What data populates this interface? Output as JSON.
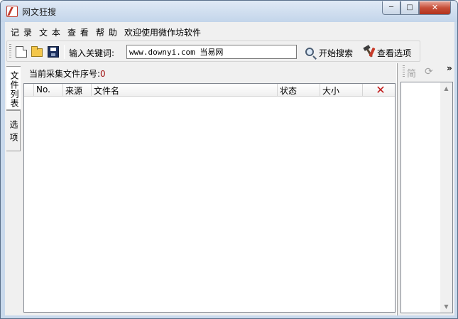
{
  "window": {
    "title": "网文狂搜",
    "minimize": "─",
    "maximize": "□",
    "close": "✕"
  },
  "menu": {
    "items": [
      "记 录",
      "文 本",
      "查 看",
      "帮 助",
      "欢迎使用微作坊软件"
    ]
  },
  "toolbar": {
    "keyword_label": "输入关键词:",
    "keyword_value": "www.downyi.com 当易网",
    "search_label": "开始搜索",
    "options_label": "查看选项"
  },
  "tabs": {
    "file_list": "文件列表",
    "options": "选项"
  },
  "main": {
    "serial_label": "当前采集文件序号:",
    "serial_value": "0",
    "columns": [
      "No.",
      "来源",
      "文件名",
      "状态",
      "大小"
    ],
    "delete_symbol": "✕"
  },
  "right_panel": {
    "simple_label": "简",
    "refresh_symbol": "⟳",
    "more_symbol": "»",
    "scroll_up": "▲",
    "scroll_down": "▼"
  },
  "colors": {
    "serial_number": "#a01010",
    "delete": "#c01818",
    "close_button": "#c74f39"
  },
  "icons": [
    "app-icon",
    "new-file-icon",
    "open-folder-icon",
    "save-icon",
    "search-icon",
    "tools-icon",
    "delete-icon",
    "refresh-icon"
  ]
}
